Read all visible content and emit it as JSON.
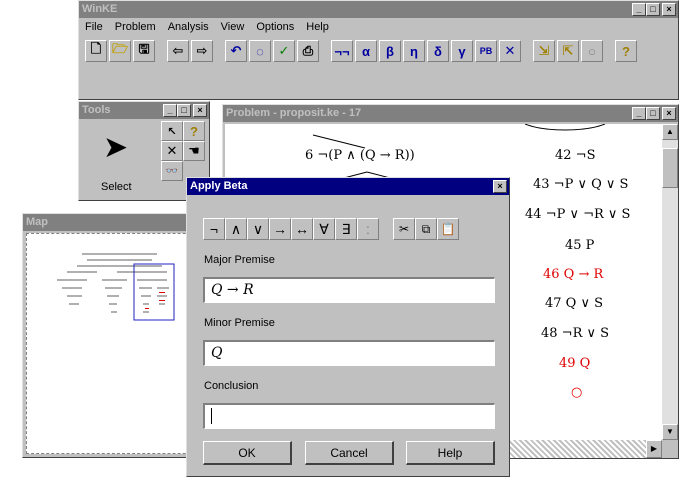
{
  "main_window": {
    "title": "WinKE",
    "menu": [
      "File",
      "Problem",
      "Analysis",
      "View",
      "Options",
      "Help"
    ],
    "toolbar": {
      "symbols": [
        "¬¬",
        "α",
        "β",
        "η",
        "δ",
        "γ",
        "PB",
        "✕"
      ]
    }
  },
  "tools_window": {
    "title": "Tools",
    "select_label": "Select"
  },
  "problem_window": {
    "title": "Problem - proposit.ke - 17",
    "left_formula": "6 ¬(P ∧ (Q → R))",
    "right_lines": [
      {
        "text": "42 ¬S",
        "color": "#000000"
      },
      {
        "text": "43 ¬P ∨ Q ∨ S",
        "color": "#000000"
      },
      {
        "text": "44 ¬P ∨ ¬R ∨ S",
        "color": "#000000"
      },
      {
        "text": "45 P",
        "color": "#000000"
      },
      {
        "text": "46 Q → R",
        "color": "#e00000"
      },
      {
        "text": "47 Q ∨ S",
        "color": "#000000"
      },
      {
        "text": "48 ¬R ∨ S",
        "color": "#000000"
      },
      {
        "text": "49 Q",
        "color": "#e00000"
      },
      {
        "text": "○",
        "color": "#e00000"
      }
    ]
  },
  "map_window": {
    "title": "Map"
  },
  "dialog": {
    "title": "Apply Beta",
    "symbols": [
      "¬",
      "∧",
      "∨",
      "→",
      "↔",
      "∀",
      "∃",
      ":"
    ],
    "major_label": "Major Premise",
    "major_value": "Q → R",
    "minor_label": "Minor Premise",
    "minor_value": "Q",
    "conclusion_label": "Conclusion",
    "conclusion_value": "",
    "ok_label": "OK",
    "cancel_label": "Cancel",
    "help_label": "Help"
  }
}
